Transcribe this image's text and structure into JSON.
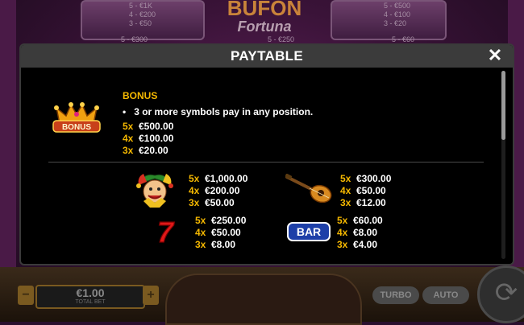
{
  "background": {
    "top_left_pays": [
      "5 - €1K",
      "4 - €200",
      "3 - €50"
    ],
    "top_right_pays": [
      "5 - €500",
      "4 - €100",
      "3 - €20"
    ],
    "mid_left_pay": "5 - €300",
    "mid_center_pay": "5 - €250",
    "mid_right_pay": "5 - €60",
    "logo_line1": "BUFON",
    "logo_line2": "Fortuna",
    "bet_value": "€1.00",
    "bet_label": "TOTAL BET",
    "minus_label": "−",
    "plus_label": "+",
    "turbo_label": "TURBO",
    "auto_label": "AUTO"
  },
  "modal": {
    "title": "PAYTABLE",
    "close_label": "✕"
  },
  "bonus": {
    "title": "BONUS",
    "icon_text": "BONUS",
    "rule": "3 or more symbols pay in any position.",
    "pays": [
      {
        "count": "5x",
        "amount": "€500.00"
      },
      {
        "count": "4x",
        "amount": "€100.00"
      },
      {
        "count": "3x",
        "amount": "€20.00"
      }
    ]
  },
  "symbols": [
    {
      "name": "jester",
      "icon": "jester-icon",
      "pays": [
        {
          "count": "5x",
          "amount": "€1,000.00"
        },
        {
          "count": "4x",
          "amount": "€200.00"
        },
        {
          "count": "3x",
          "amount": "€50.00"
        }
      ]
    },
    {
      "name": "lute",
      "icon": "lute-icon",
      "pays": [
        {
          "count": "5x",
          "amount": "€300.00"
        },
        {
          "count": "4x",
          "amount": "€50.00"
        },
        {
          "count": "3x",
          "amount": "€12.00"
        }
      ]
    },
    {
      "name": "seven",
      "icon": "seven-icon",
      "glyph": "7",
      "pays": [
        {
          "count": "5x",
          "amount": "€250.00"
        },
        {
          "count": "4x",
          "amount": "€50.00"
        },
        {
          "count": "3x",
          "amount": "€8.00"
        }
      ]
    },
    {
      "name": "bar",
      "icon": "bar-icon",
      "glyph": "BAR",
      "pays": [
        {
          "count": "5x",
          "amount": "€60.00"
        },
        {
          "count": "4x",
          "amount": "€8.00"
        },
        {
          "count": "3x",
          "amount": "€4.00"
        }
      ]
    }
  ],
  "colors": {
    "gold": "#f5b800",
    "seven_red": "#e01818",
    "bar_blue": "#1d3fa8"
  }
}
